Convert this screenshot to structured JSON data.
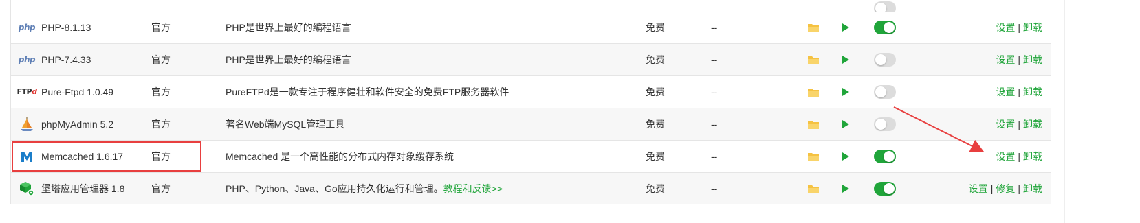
{
  "colors": {
    "accent": "#20a53a",
    "toggle_off": "#dcdcdc",
    "highlight": "#e83f3f",
    "row_alt": "#f7f7f7",
    "folder": "#f5c242"
  },
  "rows": [
    {
      "icon": "php-logo-icon",
      "icon_text": "php",
      "name": "PHP-8.1.13",
      "type": "官方",
      "desc": "PHP是世界上最好的编程语言",
      "desc_link": "",
      "price": "免费",
      "expire": "--",
      "enabled": true,
      "ops": [
        "设置",
        "卸载"
      ]
    },
    {
      "icon": "php-logo-icon",
      "icon_text": "php",
      "name": "PHP-7.4.33",
      "type": "官方",
      "desc": "PHP是世界上最好的编程语言",
      "desc_link": "",
      "price": "免费",
      "expire": "--",
      "enabled": false,
      "ops": [
        "设置",
        "卸载"
      ]
    },
    {
      "icon": "ftp-logo-icon",
      "icon_text": "FTP",
      "name": "Pure-Ftpd 1.0.49",
      "type": "官方",
      "desc": "PureFTPd是一款专注于程序健壮和软件安全的免费FTP服务器软件",
      "desc_link": "",
      "price": "免费",
      "expire": "--",
      "enabled": false,
      "ops": [
        "设置",
        "卸载"
      ]
    },
    {
      "icon": "sailboat-icon",
      "icon_text": "",
      "name": "phpMyAdmin 5.2",
      "type": "官方",
      "desc": "著名Web端MySQL管理工具",
      "desc_link": "",
      "price": "免费",
      "expire": "--",
      "enabled": false,
      "ops": [
        "设置",
        "卸载"
      ]
    },
    {
      "icon": "memcached-m-icon",
      "icon_text": "",
      "name": "Memcached 1.6.17",
      "type": "官方",
      "desc": "Memcached 是一个高性能的分布式内存对象缓存系统",
      "desc_link": "",
      "price": "免费",
      "expire": "--",
      "enabled": true,
      "ops": [
        "设置",
        "卸载"
      ]
    },
    {
      "icon": "cube-gear-icon",
      "icon_text": "",
      "name": "堡塔应用管理器 1.8",
      "type": "官方",
      "desc": "PHP、Python、Java、Go应用持久化运行和管理。",
      "desc_link": "教程和反馈>>",
      "price": "免费",
      "expire": "--",
      "enabled": true,
      "ops": [
        "设置",
        "修复",
        "卸载"
      ]
    }
  ]
}
